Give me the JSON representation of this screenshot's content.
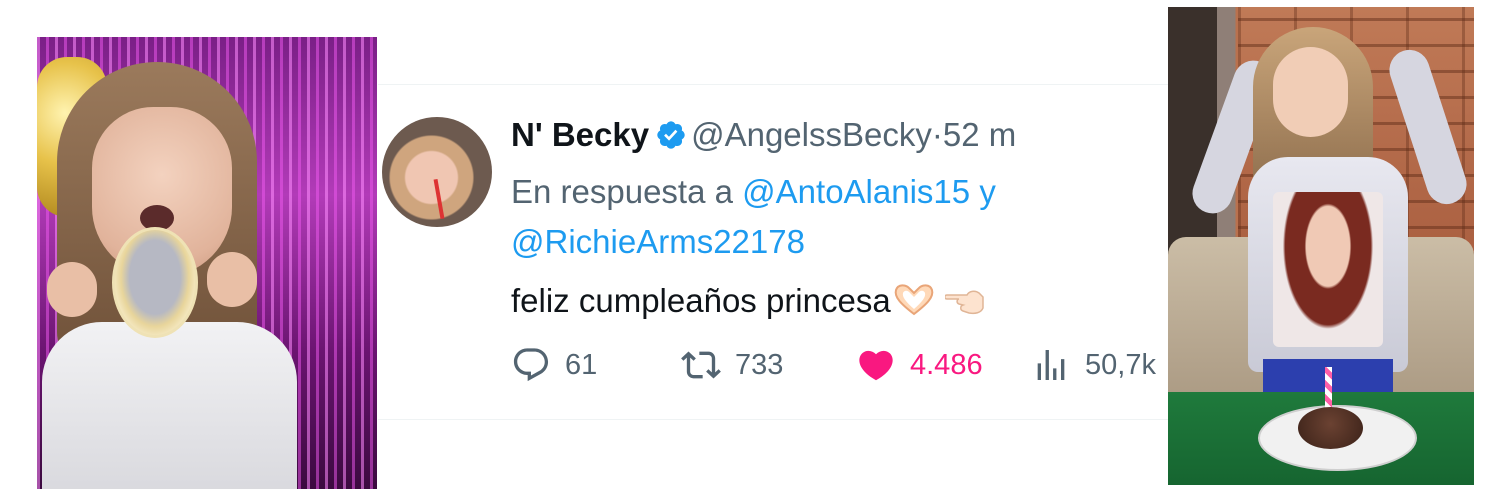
{
  "tweet": {
    "display_name": "N' Becky",
    "handle": "@AngelssBecky",
    "separator": "·",
    "time": "52 m",
    "reply_prefix": "En respuesta a",
    "reply_mention_1": "@AntoAlanis15",
    "reply_joiner": "y",
    "reply_mention_2": "@RichieArms22178",
    "text": "feliz cumpleaños princesa",
    "emojis": [
      "heart-hands",
      "backhand-index-pointing-left"
    ],
    "stats": {
      "replies": "61",
      "retweets": "733",
      "likes": "4.486",
      "views": "50,7k"
    },
    "like_active": true
  },
  "colors": {
    "text_primary": "#0f1419",
    "text_secondary": "#536471",
    "link": "#1d9bf0",
    "like": "#f91880",
    "verified": "#1d9bf0"
  },
  "icons": {
    "reply": "reply-icon",
    "retweet": "retweet-icon",
    "like": "heart-icon",
    "views": "views-icon",
    "verified": "verified-badge-icon"
  }
}
